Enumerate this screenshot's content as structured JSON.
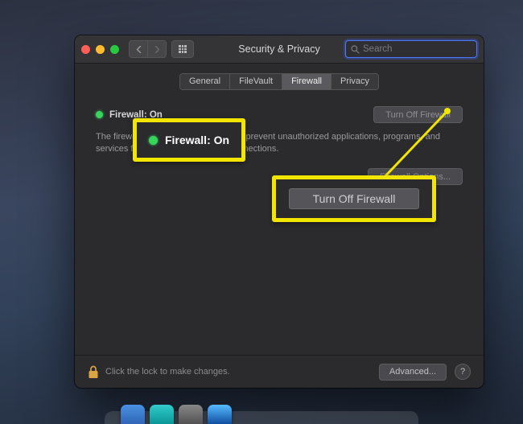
{
  "window": {
    "title": "Security & Privacy"
  },
  "search": {
    "placeholder": "Search"
  },
  "tabs": {
    "general": "General",
    "filevault": "FileVault",
    "firewall": "Firewall",
    "privacy": "Privacy"
  },
  "firewall": {
    "status_label": "Firewall: On",
    "turn_off_btn": "Turn Off Firewall",
    "description": "The firewall is turned on and set up to prevent unauthorized applications, programs, and services from accepting incoming connections.",
    "options_btn": "Firewall Options..."
  },
  "callout": {
    "status": "Firewall: On",
    "turn_off": "Turn Off Firewall"
  },
  "footer": {
    "lock_text": "Click the lock to make changes.",
    "advanced_btn": "Advanced...",
    "help": "?"
  },
  "colors": {
    "highlight": "#f2e600",
    "led": "#37d65a"
  }
}
